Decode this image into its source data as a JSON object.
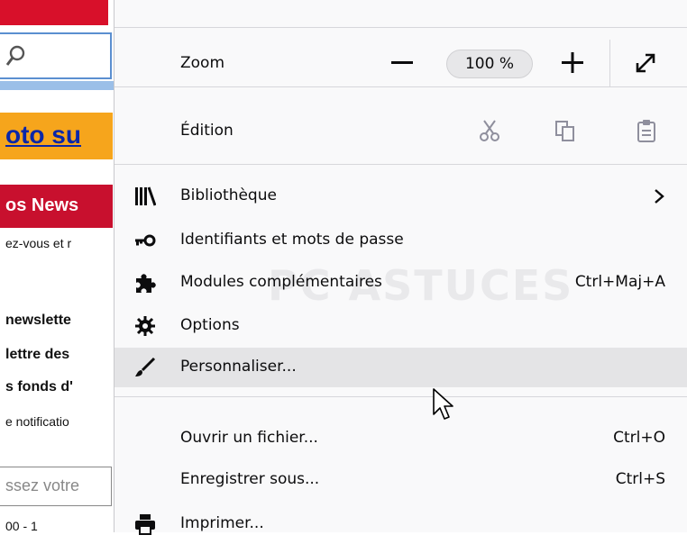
{
  "background_page": {
    "promo_text": "oto su",
    "news_header": "os News",
    "lines": [
      "ez-vous et r",
      "newslette",
      "lettre des",
      "s fonds d'",
      "e notificatio"
    ],
    "input_placeholder": "ssez votre",
    "last_line": "00 - 1"
  },
  "watermark": "PC ASTUCES",
  "menu": {
    "zoom": {
      "label": "Zoom",
      "value": "100 %"
    },
    "edit": {
      "label": "Édition"
    },
    "items": [
      {
        "label": "Bibliothèque",
        "icon": "library-icon",
        "shortcut": ""
      },
      {
        "label": "Identifiants et mots de passe",
        "icon": "key-icon",
        "shortcut": ""
      },
      {
        "label": "Modules complémentaires",
        "icon": "puzzle-icon",
        "shortcut": "Ctrl+Maj+A"
      },
      {
        "label": "Options",
        "icon": "gear-icon",
        "shortcut": ""
      },
      {
        "label": "Personnaliser...",
        "icon": "paintbrush-icon",
        "shortcut": ""
      },
      {
        "label": "Ouvrir un fichier...",
        "icon": "",
        "shortcut": "Ctrl+O"
      },
      {
        "label": "Enregistrer sous...",
        "icon": "",
        "shortcut": "Ctrl+S"
      },
      {
        "label": "Imprimer...",
        "icon": "printer-icon",
        "shortcut": ""
      }
    ]
  }
}
